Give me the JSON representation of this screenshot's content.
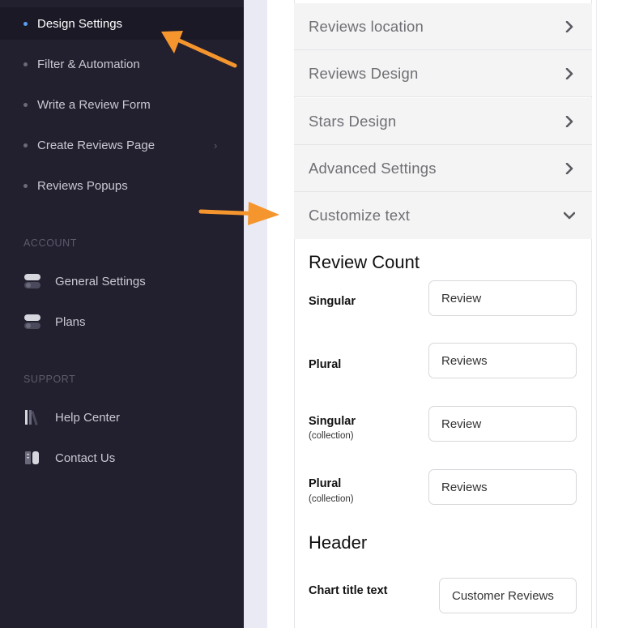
{
  "sidebar": {
    "nav_items": [
      {
        "label": "Design Settings",
        "active": true
      },
      {
        "label": "Filter & Automation"
      },
      {
        "label": "Write a Review Form"
      },
      {
        "label": "Create Reviews Page",
        "has_chevron": true,
        "chevron": "›"
      },
      {
        "label": "Reviews Popups"
      }
    ],
    "account_title": "ACCOUNT",
    "account_items": [
      {
        "label": "General Settings",
        "icon": "toggle-icon"
      },
      {
        "label": "Plans",
        "icon": "toggle-icon"
      }
    ],
    "support_title": "SUPPORT",
    "support_items": [
      {
        "label": "Help Center",
        "icon": "books-icon"
      },
      {
        "label": "Contact Us",
        "icon": "contact-icon"
      }
    ]
  },
  "accordion": [
    {
      "label": "Reviews location",
      "state": "collapsed"
    },
    {
      "label": "Reviews Design",
      "state": "collapsed"
    },
    {
      "label": "Stars Design",
      "state": "collapsed"
    },
    {
      "label": "Advanced Settings",
      "state": "collapsed"
    },
    {
      "label": "Customize text",
      "state": "expanded"
    }
  ],
  "customize_text": {
    "review_count_heading": "Review Count",
    "fields": [
      {
        "label": "Singular",
        "sub": "",
        "value": "Review"
      },
      {
        "label": "Plural",
        "sub": "",
        "value": "Reviews"
      },
      {
        "label": "Singular",
        "sub": "(collection)",
        "value": "Review"
      },
      {
        "label": "Plural",
        "sub": "(collection)",
        "value": "Reviews"
      }
    ],
    "header_heading": "Header",
    "chart_title_label": "Chart title text",
    "chart_title_value": "Customer Reviews"
  },
  "colors": {
    "sidebar_bg": "#22202e",
    "active_dot": "#5b9df0",
    "annotation_arrow": "#f5952e"
  }
}
